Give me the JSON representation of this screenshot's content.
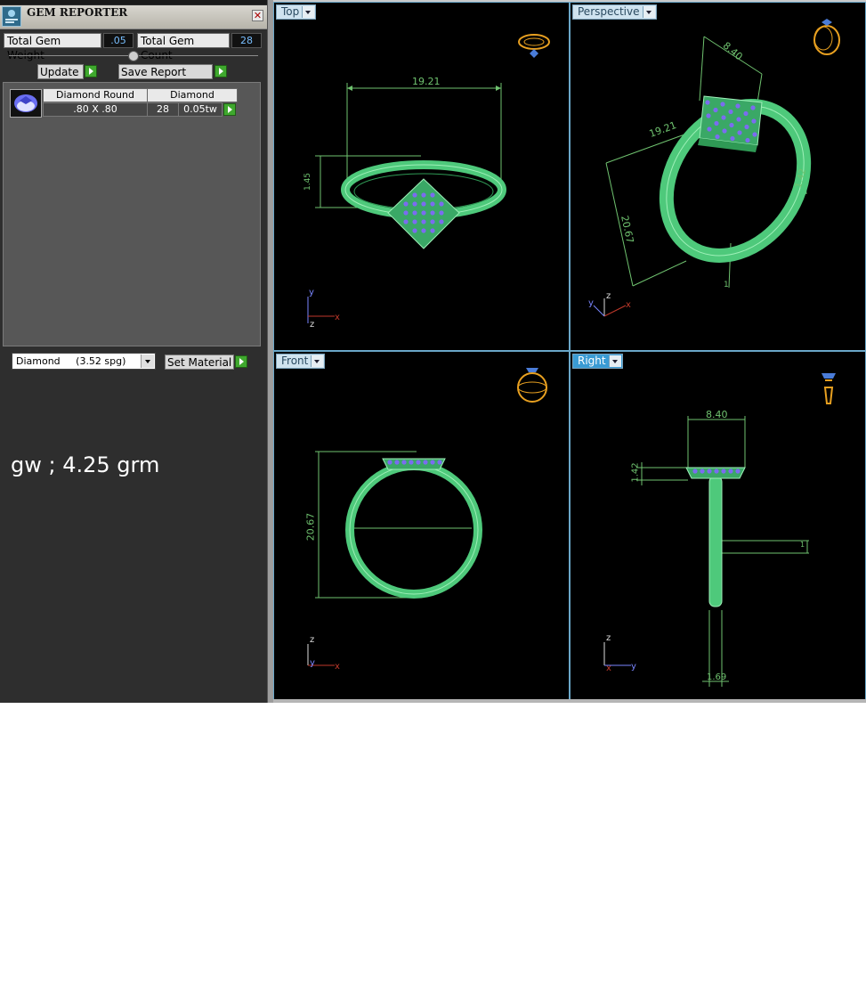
{
  "panel": {
    "title": "GEM REPORTER",
    "total_weight_label": "Total Gem Weight",
    "total_weight_value": ".05",
    "total_count_label": "Total Gem Count",
    "total_count_value": "28",
    "update_label": "Update",
    "save_report_label": "Save Report",
    "gems": [
      {
        "shape": "Diamond Round",
        "size": ".80 X .80",
        "material": "Diamond",
        "count": "28",
        "weight": "0.05tw"
      }
    ],
    "material_select": "Diamond     (3.52 spg)",
    "set_material_label": "Set Material",
    "note": "gw ; 4.25 grm"
  },
  "viewports": {
    "top": {
      "label": "Top",
      "dims": [
        "19.21",
        "1.45"
      ],
      "axes": [
        "y",
        "z",
        "x"
      ]
    },
    "perspective": {
      "label": "Perspective",
      "dims": [
        "8.40",
        "19.21",
        "20.67",
        "1.42",
        "1"
      ],
      "axes": [
        "z",
        "y",
        "x"
      ]
    },
    "front": {
      "label": "Front",
      "dims": [
        "20.67"
      ],
      "axes": [
        "z",
        "y",
        "x"
      ]
    },
    "right": {
      "label": "Right",
      "dims": [
        "8.40",
        "1.42",
        "1.69",
        "1"
      ],
      "axes": [
        "z",
        "x",
        "y"
      ]
    }
  },
  "colors": {
    "model": "#4ec97b",
    "gems": "#7b6cf0",
    "dimension": "#6fc26f",
    "active_tab": "#3a9bd4",
    "axis_x": "#c0392b",
    "axis_y": "#7a86ff",
    "axis_z": "#dddddd",
    "preview": "#e8a020"
  }
}
